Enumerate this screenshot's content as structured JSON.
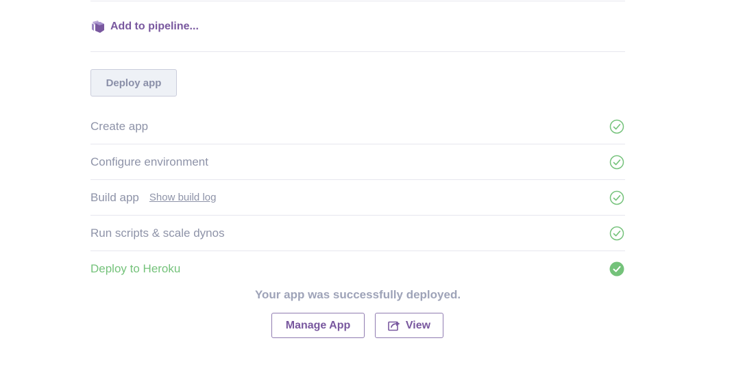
{
  "pipeline": {
    "label": "Add to pipeline...",
    "icon": "pipeline-icon"
  },
  "deploy_button": {
    "label": "Deploy app"
  },
  "steps": [
    {
      "label": "Create app",
      "status": "complete",
      "icon": "check-circle-icon"
    },
    {
      "label": "Configure environment",
      "status": "complete",
      "icon": "check-circle-icon"
    },
    {
      "label": "Build app",
      "status": "complete",
      "link": "Show build log",
      "icon": "check-circle-icon"
    },
    {
      "label": "Run scripts & scale dynos",
      "status": "complete",
      "icon": "check-circle-icon"
    },
    {
      "label": "Deploy to Heroku",
      "status": "done",
      "icon": "check-circle-filled-icon"
    }
  ],
  "result": {
    "message": "Your app was successfully deployed.",
    "manage_label": "Manage App",
    "view_label": "View",
    "view_icon": "external-link-icon"
  },
  "colors": {
    "brand_purple": "#79589f",
    "success_green": "#74c27a",
    "muted_text": "#8e93a8",
    "divider": "#e6e6ee"
  }
}
